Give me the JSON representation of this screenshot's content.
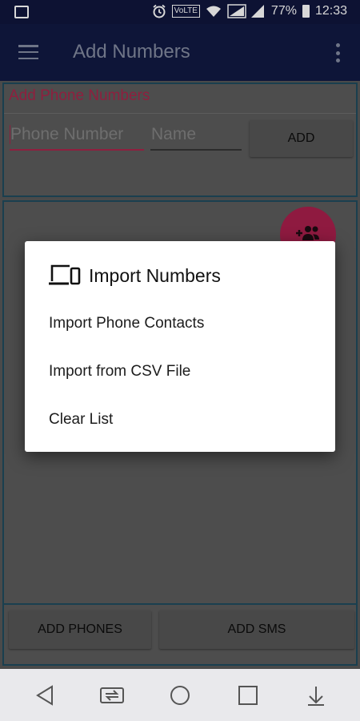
{
  "status_bar": {
    "volte": "VoLTE",
    "battery": "77%",
    "time": "12:33",
    "icons": [
      "gallery-icon",
      "alarm-icon",
      "wifi-icon",
      "signal-icon",
      "battery-icon"
    ]
  },
  "app_bar": {
    "title": "Add Numbers",
    "icons": [
      "menu-icon",
      "more-vert-icon"
    ]
  },
  "add_section": {
    "label": "Add Phone Numbers",
    "phone_placeholder": "Phone Number",
    "name_placeholder": "Name",
    "add_button": "ADD"
  },
  "bottom_buttons": {
    "add_phones": "ADD PHONES",
    "add_sms": "ADD SMS"
  },
  "dialog": {
    "title": "Import Numbers",
    "items": [
      {
        "label": "Import Phone Contacts"
      },
      {
        "label": "Import from CSV File"
      },
      {
        "label": "Clear List"
      }
    ]
  },
  "nav_bar": {
    "icons": [
      "back-icon",
      "switch-app-icon",
      "home-icon",
      "recents-icon",
      "notification-pull-icon"
    ]
  },
  "colors": {
    "status_bar": "#0d1233",
    "app_bar": "#0e1538",
    "accent": "#e91e63",
    "scrim": "#4a4a4a",
    "dialog_bg": "#ffffff"
  }
}
